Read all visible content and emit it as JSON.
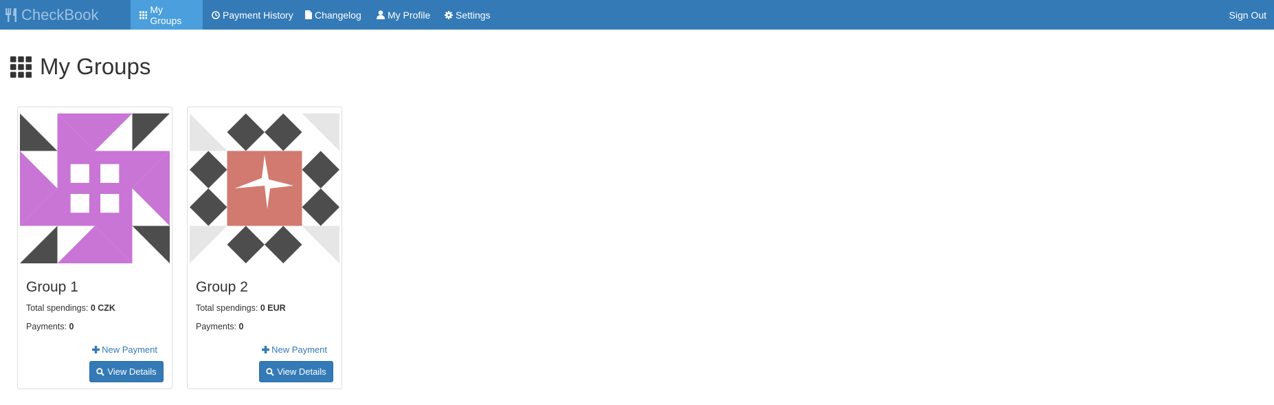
{
  "app": {
    "brand": "CheckBook"
  },
  "nav": {
    "items": [
      {
        "label": "My Groups",
        "icon": "grid-icon",
        "active": true
      },
      {
        "label": "Payment History",
        "icon": "clock-icon",
        "active": false
      },
      {
        "label": "Changelog",
        "icon": "file-icon",
        "active": false
      },
      {
        "label": "My Profile",
        "icon": "user-icon",
        "active": false
      },
      {
        "label": "Settings",
        "icon": "gear-icon",
        "active": false
      }
    ],
    "signout": "Sign Out"
  },
  "page": {
    "title": "My Groups"
  },
  "groups": [
    {
      "name": "Group 1",
      "spend_label": "Total spendings:",
      "spend_value": "0 CZK",
      "payments_label": "Payments:",
      "payments_value": "0",
      "new_payment": "New Payment",
      "view_details": "View Details",
      "identicon_color": "#c875d6"
    },
    {
      "name": "Group 2",
      "spend_label": "Total spendings:",
      "spend_value": "0 EUR",
      "payments_label": "Payments:",
      "payments_value": "0",
      "new_payment": "New Payment",
      "view_details": "View Details",
      "identicon_color": "#d27a6f"
    }
  ],
  "colors": {
    "navbar": "#337ab7",
    "active_tab": "#4a9fdc",
    "identicon_dark": "#4d4d4d",
    "identicon_light": "#e6e6e6"
  }
}
